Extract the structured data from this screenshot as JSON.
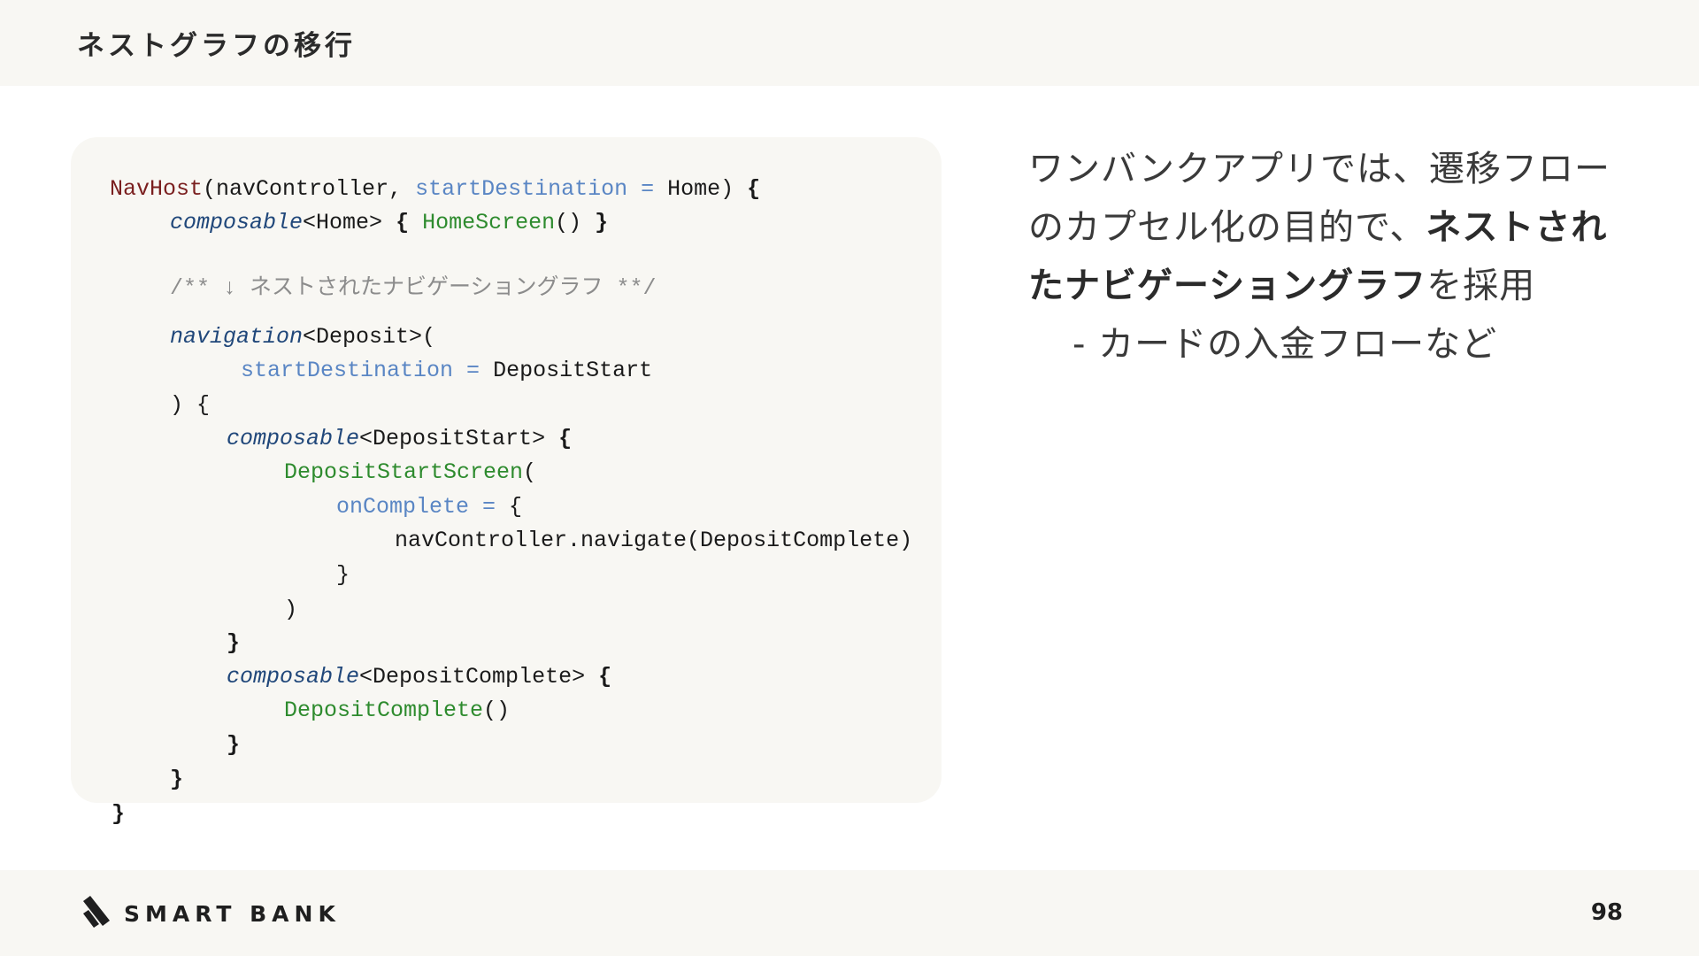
{
  "header": {
    "title": "ネストグラフの移行"
  },
  "code": {
    "line1_navhost": "NavHost",
    "line1_open": "(navController, ",
    "line1_param": "startDestination",
    "line1_eq": " = ",
    "line1_val": "Home) ",
    "line1_brace": "{",
    "line2_composable": "composable",
    "line2_type": "<Home> ",
    "line2_open": "{",
    "line2_call": " HomeScreen",
    "line2_args": "() ",
    "line2_close": "}",
    "line3_comment": "/** ↓ ネストされたナビゲーショングラフ **/",
    "line4_navigation": "navigation",
    "line4_type": "<Deposit>(",
    "line5_param": "startDestination",
    "line5_eq": " = ",
    "line5_val": "DepositStart",
    "line6": ") {",
    "line7_composable": "composable",
    "line7_type": "<DepositStart> ",
    "line7_brace": "{",
    "line8_call": "DepositStartScreen",
    "line8_open": "(",
    "line9_param": "onComplete",
    "line9_eq": " = ",
    "line9_brace": "{",
    "line10": "navController.navigate(DepositComplete)",
    "line11": "}",
    "line12": ")",
    "line13": "}",
    "line14_composable": "composable",
    "line14_type": "<DepositComplete> ",
    "line14_brace": "{",
    "line15_call": "DepositComplete",
    "line15_args": "()",
    "line16": "}",
    "line17": "}",
    "line18": "}"
  },
  "description": {
    "text_before": "ワンバンクアプリでは、遷移フローのカプセル化の目的で、",
    "text_strong": "ネストされたナビゲーショングラフ",
    "text_after": "を採用",
    "bullet": "- カードの入金フローなど"
  },
  "footer": {
    "logo_text": "SMART BANK",
    "page_number": "98"
  },
  "colors": {
    "background": "#ffffff",
    "panel": "#f8f7f3",
    "keyword": "#7a1f1f",
    "param": "#5a86c4",
    "function": "#2e8b2e",
    "italic_builder": "#20477a",
    "comment": "#8c8c8c"
  }
}
